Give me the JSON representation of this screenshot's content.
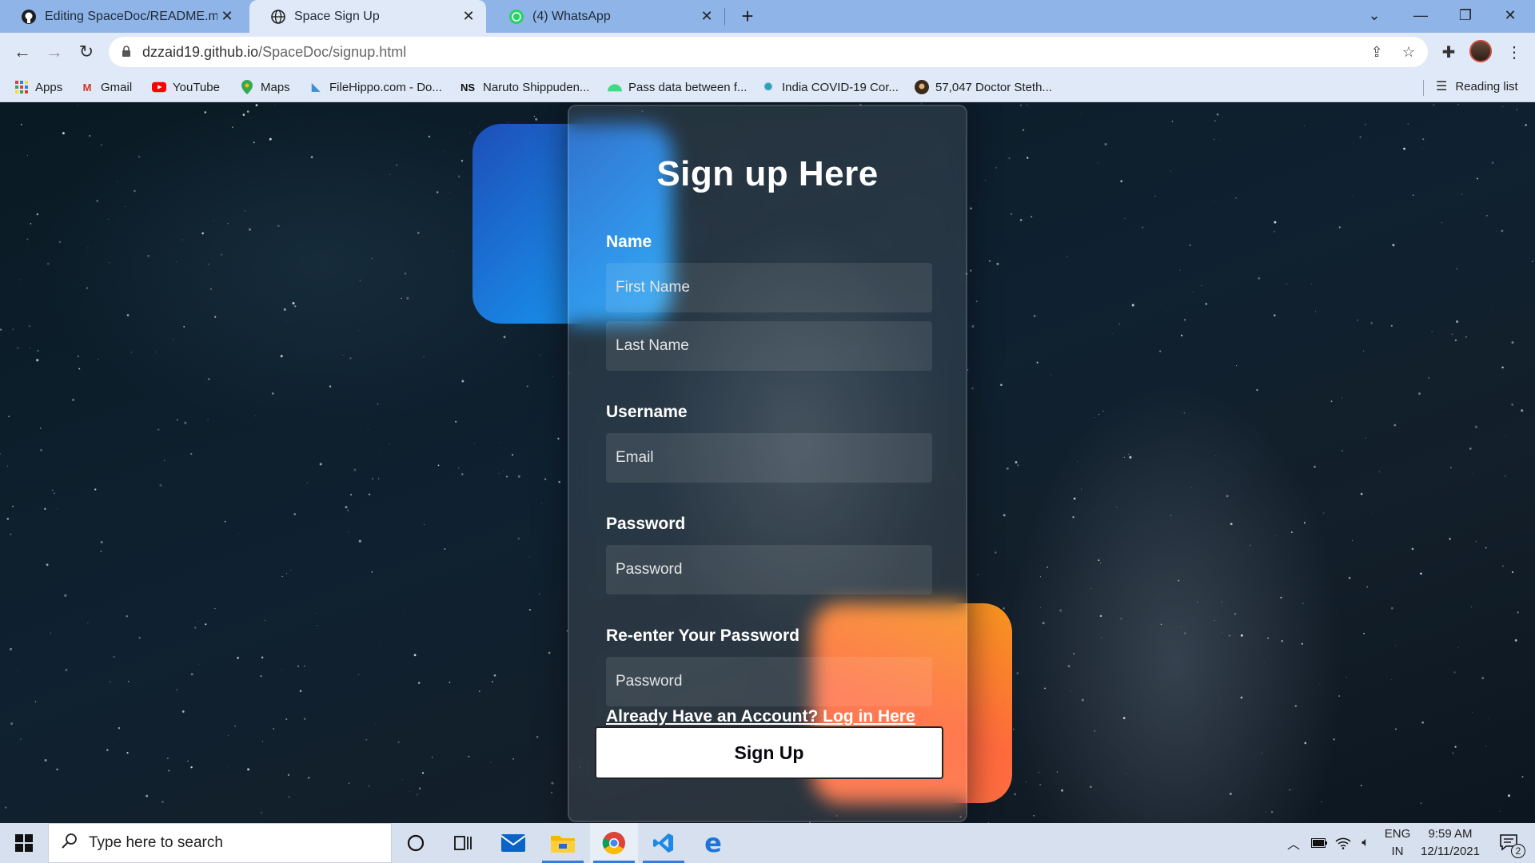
{
  "browser": {
    "tabs": [
      {
        "title": "Editing SpaceDoc/README.md a",
        "icon": "github-icon"
      },
      {
        "title": "Space Sign Up",
        "icon": "globe-icon"
      },
      {
        "title": "(4) WhatsApp",
        "icon": "whatsapp-icon"
      }
    ],
    "active_tab": 1,
    "url_host": "dzzaid19.github.io",
    "url_path": "/SpaceDoc/signup.html",
    "bookmarks": [
      {
        "label": "Apps",
        "icon": "apps-grid-icon"
      },
      {
        "label": "Gmail",
        "icon": "gmail-icon"
      },
      {
        "label": "YouTube",
        "icon": "youtube-icon"
      },
      {
        "label": "Maps",
        "icon": "maps-icon"
      },
      {
        "label": "FileHippo.com - Do...",
        "icon": "filehippo-icon"
      },
      {
        "label": "Naruto Shippuden...",
        "icon": "ns-icon"
      },
      {
        "label": "Pass data between f...",
        "icon": "android-icon"
      },
      {
        "label": "India COVID-19 Cor...",
        "icon": "covid-icon"
      },
      {
        "label": "57,047 Doctor Steth...",
        "icon": "doctor-icon"
      }
    ],
    "reading_list": "Reading list"
  },
  "form": {
    "heading": "Sign up Here",
    "name_label": "Name",
    "first_name_placeholder": "First Name",
    "last_name_placeholder": "Last Name",
    "username_label": "Username",
    "email_placeholder": "Email",
    "password_label": "Password",
    "password_placeholder": "Password",
    "reenter_label": "Re-enter Your Password",
    "reenter_placeholder": "Password",
    "login_link": "Already Have an Account? Log in Here",
    "signup_button": "Sign Up"
  },
  "taskbar": {
    "search_placeholder": "Type here to search",
    "lang_top": "ENG",
    "lang_bottom": "IN",
    "time": "9:59 AM",
    "date": "12/11/2021",
    "notifications": "2"
  },
  "colors": {
    "tab_bar": "#8fb4e8",
    "toolbar": "#dfe9f7",
    "blue_shape": "#1a8be8",
    "orange_shape": "#ff6a3d"
  }
}
